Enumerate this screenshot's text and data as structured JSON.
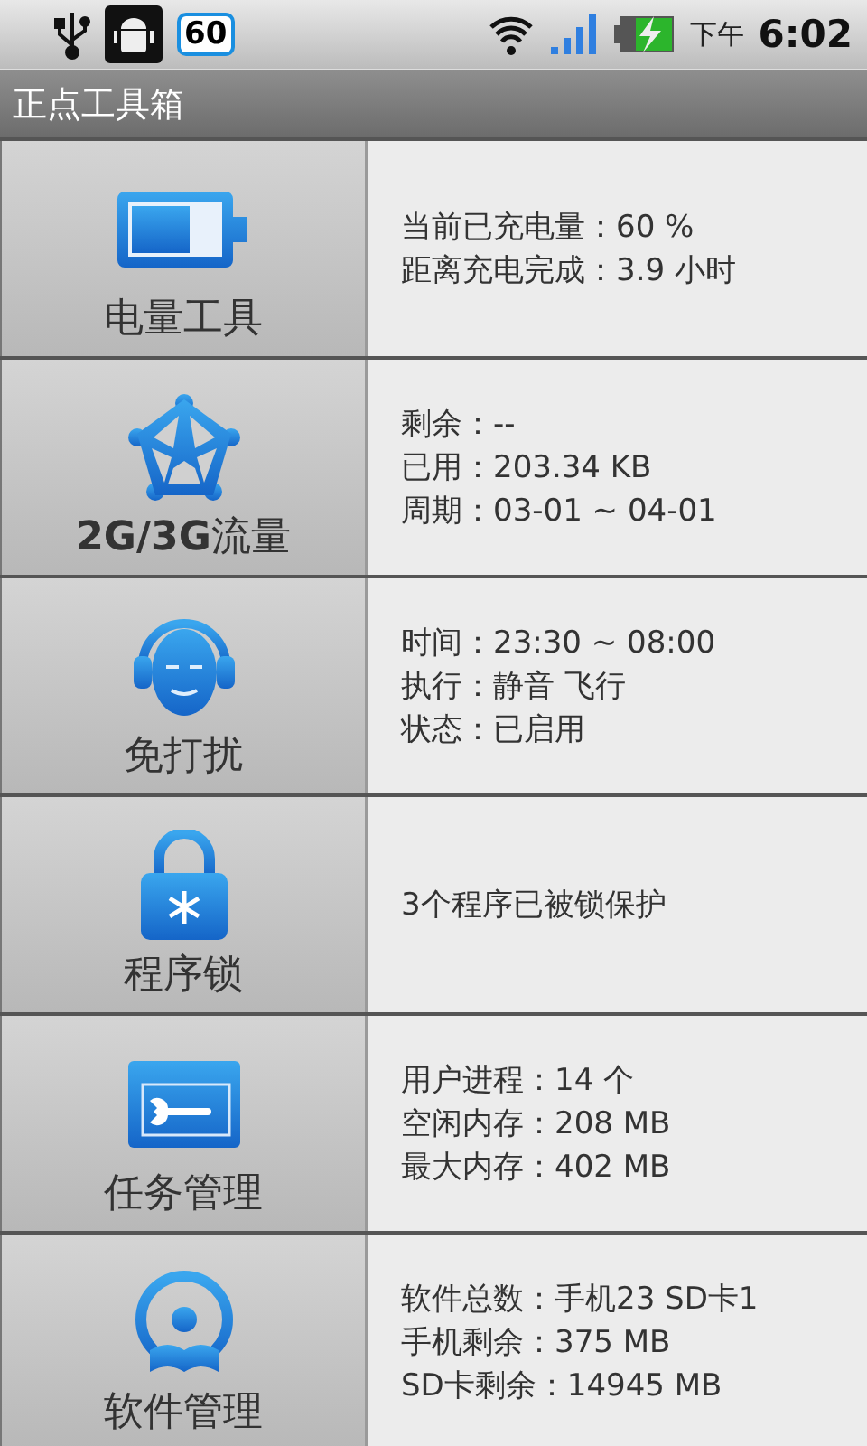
{
  "status_bar": {
    "battery_badge": "60",
    "am_pm": "下午",
    "time": "6:02"
  },
  "title_bar": {
    "title": "正点工具箱"
  },
  "tools": [
    {
      "kind": "battery",
      "label": "电量工具",
      "lines": [
        "当前已充电量：60 %",
        "距离充电完成：3.9 小时"
      ]
    },
    {
      "kind": "traffic",
      "label": "**2G/3G**流量",
      "lines": [
        "剩余：--",
        "已用：203.34 KB",
        "周期：03-01 ~ 04-01"
      ]
    },
    {
      "kind": "quiet",
      "label": "免打扰",
      "lines": [
        "时间：23:30 ~ 08:00",
        "执行：静音 飞行",
        "状态：已启用"
      ]
    },
    {
      "kind": "lock",
      "label": "程序锁",
      "lines": [
        "3个程序已被锁保护"
      ]
    },
    {
      "kind": "task",
      "label": "任务管理",
      "lines": [
        "用户进程：14 个",
        "空闲内存：208 MB",
        "最大内存：402 MB"
      ]
    },
    {
      "kind": "software",
      "label": "软件管理",
      "lines": [
        "软件总数：手机23 SD卡1",
        "手机剩余：375 MB",
        "SD卡剩余：14945 MB"
      ]
    }
  ]
}
